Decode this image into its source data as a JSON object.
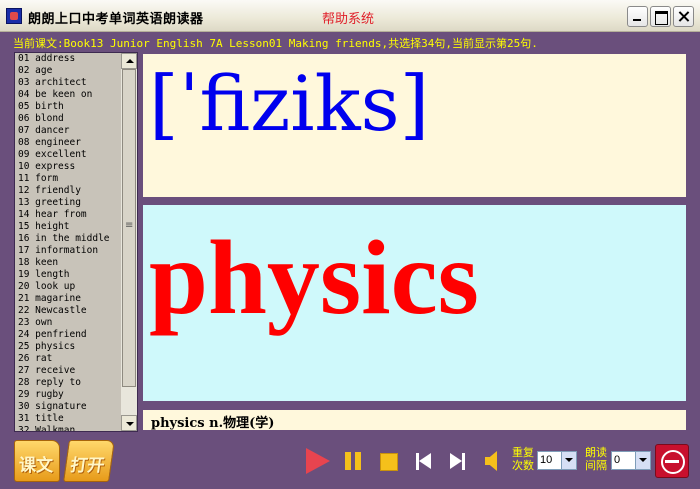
{
  "window": {
    "title": "朗朗上口中考单词英语朗读器",
    "help": "帮助系统"
  },
  "status_text": "当前课文:Book13 Junior English 7A Lesson01 Making friends,共选择34句,当前显示第25句.",
  "word_list": [
    "01 address",
    "02 age",
    "03 architect",
    "04 be keen on",
    "05 birth",
    "06 blond",
    "07 dancer",
    "08 engineer",
    "09 excellent",
    "10 express",
    "11 form",
    "12 friendly",
    "13 greeting",
    "14 hear from",
    "15 height",
    "16 in the middle",
    "17 information",
    "18 keen",
    "19 length",
    "20 look up",
    "21 magarine",
    "22 Newcastle",
    "23 own",
    "24 penfriend",
    "25 physics",
    "26 rat",
    "27 receive",
    "28 reply to",
    "29 rugby",
    "30 signature",
    "31 title",
    "32 Walkman"
  ],
  "current": {
    "phonetic": "[ˈfiziks]",
    "word": "physics",
    "meaning": "physics n.物理(学)"
  },
  "toolbar": {
    "text_folder_label": "课文",
    "open_folder_label": "打开",
    "repeat_label": "重复次数",
    "repeat_value": "10",
    "interval_label": "朗读间隔",
    "interval_value": "0"
  },
  "colors": {
    "background": "#6a4f7c",
    "status_text": "#ffff00",
    "phonetic": "#0000ee",
    "word": "#ff0000"
  }
}
